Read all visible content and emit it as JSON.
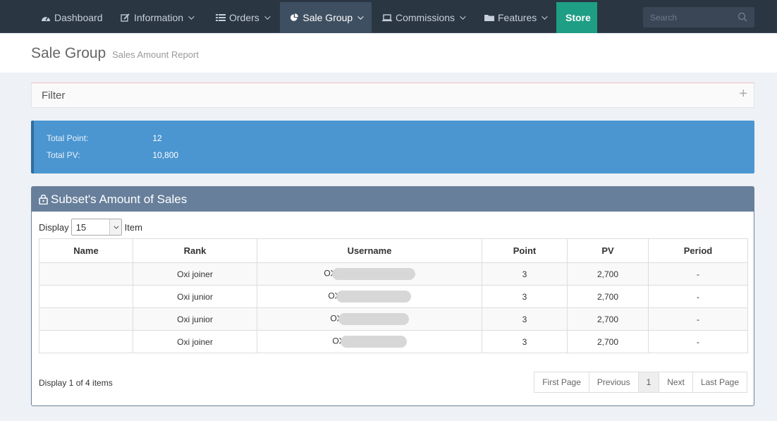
{
  "nav": {
    "items": [
      {
        "label": "Dashboard",
        "icon": "dashboard-icon"
      },
      {
        "label": "Information",
        "icon": "edit-icon"
      },
      {
        "label": "Orders",
        "icon": "list-icon"
      },
      {
        "label": "Sale Group",
        "icon": "pie-chart-icon"
      },
      {
        "label": "Commissions",
        "icon": "laptop-icon"
      },
      {
        "label": "Features",
        "icon": "folder-icon"
      }
    ],
    "store_label": "Store",
    "search_placeholder": "Search"
  },
  "header": {
    "title": "Sale Group",
    "subtitle": "Sales Amount Report"
  },
  "filter": {
    "title": "Filter",
    "toggle": "+"
  },
  "stats": {
    "total_point_label": "Total Point:",
    "total_point_value": "12",
    "total_pv_label": "Total PV:",
    "total_pv_value": "10,800",
    "color": "#4b96d1"
  },
  "portlet": {
    "title": "Subset's Amount of Sales",
    "display_label": "Display",
    "display_value": "15",
    "item_label": "Item",
    "columns": [
      "Name",
      "Rank",
      "Username",
      "Point",
      "PV",
      "Period"
    ],
    "rows": [
      {
        "name": "",
        "rank": "Oxi joiner",
        "username": "OX",
        "point": "3",
        "pv": "2,700",
        "period": "-"
      },
      {
        "name": "",
        "rank": "Oxi junior",
        "username": "OX",
        "point": "3",
        "pv": "2,700",
        "period": "-"
      },
      {
        "name": "",
        "rank": "Oxi junior",
        "username": "OX",
        "point": "3",
        "pv": "2,700",
        "period": "-"
      },
      {
        "name": "",
        "rank": "Oxi joiner",
        "username": "OX",
        "point": "3",
        "pv": "2,700",
        "period": "-"
      }
    ],
    "footer_info": "Display 1 of 4 items",
    "pager": {
      "first": "First Page",
      "prev": "Previous",
      "current": "1",
      "next": "Next",
      "last": "Last Page"
    }
  },
  "colors": {
    "navbar": "#2b3643",
    "store": "#1e9e84",
    "portlet_head": "#677f9b"
  }
}
